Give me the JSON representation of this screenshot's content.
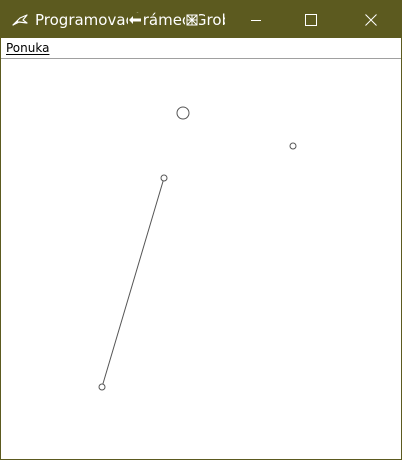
{
  "window": {
    "title": "Programovací rámec Grobb..."
  },
  "titlebar": {
    "app_icon": "bird-icon",
    "minimize_icon": "minimize-icon",
    "maximize_icon": "maximize-icon",
    "close_icon": "close-icon"
  },
  "menubar": {
    "items": [
      {
        "label": "Ponuka"
      }
    ]
  },
  "colors": {
    "titlebar": "#5c5a1f",
    "canvas": "#ffffff",
    "stroke": "#555555"
  }
}
